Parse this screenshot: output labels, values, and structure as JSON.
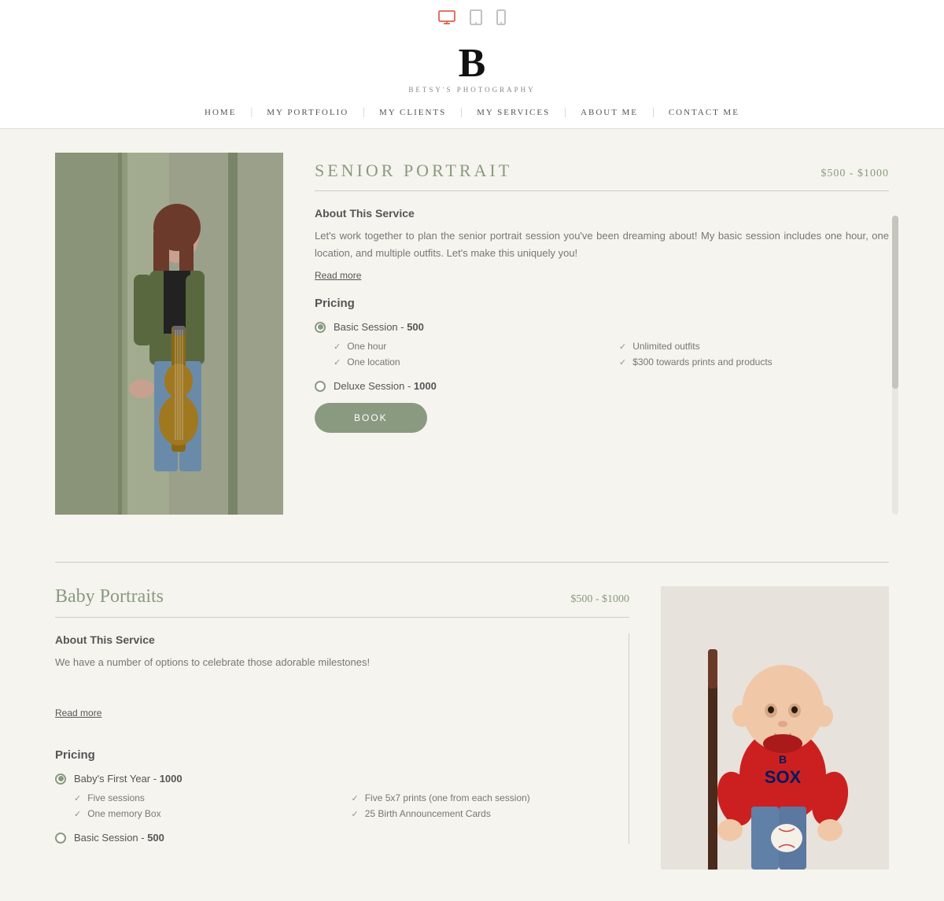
{
  "deviceBar": {
    "icons": [
      "desktop",
      "tablet",
      "mobile"
    ]
  },
  "logo": {
    "letter": "B",
    "subtitle": "BETSY'S PHOTOGRAPHY"
  },
  "nav": {
    "items": [
      {
        "label": "HOME",
        "id": "home"
      },
      {
        "label": "MY PORTFOLIO",
        "id": "portfolio"
      },
      {
        "label": "MY CLIENTS",
        "id": "clients"
      },
      {
        "label": "MY SERVICES",
        "id": "services"
      },
      {
        "label": "ABOUT ME",
        "id": "about"
      },
      {
        "label": "CONTACT ME",
        "id": "contact"
      }
    ]
  },
  "seniorPortrait": {
    "title": "SENIOR PORTRAIT",
    "price": "$500 - $1000",
    "aboutHeading": "About This Service",
    "aboutText": "Let's work together to plan the senior portrait session you've been dreaming about! My basic session includes one hour, one location, and multiple outfits. Let's make this uniquely you!",
    "readMore": "Read more",
    "pricingHeading": "Pricing",
    "basicSession": "Basic Session - ",
    "basicPrice": "500",
    "features": [
      {
        "text": "One hour"
      },
      {
        "text": "Unlimited outfits"
      },
      {
        "text": "One location"
      },
      {
        "text": "$300 towards prints and products"
      }
    ],
    "deluxeSession": "Deluxe Session - ",
    "deluxePrice": "1000",
    "bookLabel": "BOOK"
  },
  "babyPortraits": {
    "title": "Baby Portraits",
    "price": "$500 - $1000",
    "aboutHeading": "About This Service",
    "aboutText": "We have a number of options to celebrate those adorable milestones!",
    "readMore": "Read more",
    "pricingHeading": "Pricing",
    "firstYearSession": "Baby's First Year - ",
    "firstYearPrice": "1000",
    "features": [
      {
        "text": "Five sessions"
      },
      {
        "text": "Five 5x7 prints (one from each session)"
      },
      {
        "text": "One memory Box"
      },
      {
        "text": "25 Birth Announcement Cards"
      }
    ],
    "basicSession": "Basic Session - ",
    "basicPrice": "500"
  }
}
